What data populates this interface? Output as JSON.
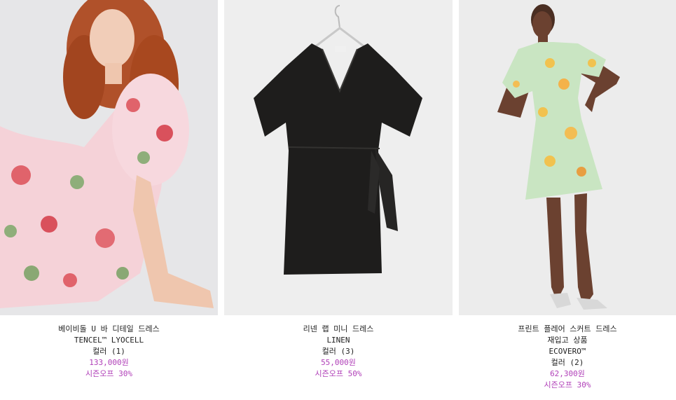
{
  "products": [
    {
      "name": "베이비돌 U 바 디테일 드레스",
      "material": "TENCEL™ LYOCELL",
      "colors": "컬러 (1)",
      "price": "133,000원",
      "sale": "시즌오프 30%",
      "image_icon": "floral-puff-sleeve-dress-photo"
    },
    {
      "name": "리넨 랩 미니 드레스",
      "material": "LINEN",
      "colors": "컬러 (3)",
      "price": "55,000원",
      "sale": "시즌오프 50%",
      "image_icon": "black-wrap-dress-on-hanger-photo"
    },
    {
      "name": "프린트 플레어 스커트 드레스",
      "subtitle": "재입고 상품",
      "material": "ECOVERO™",
      "colors": "컬러 (2)",
      "price": "62,300원",
      "sale": "시즌오프 30%",
      "image_icon": "mint-floral-mini-dress-photo"
    }
  ],
  "colors": {
    "price": "#b03fb8",
    "text": "#222222"
  }
}
